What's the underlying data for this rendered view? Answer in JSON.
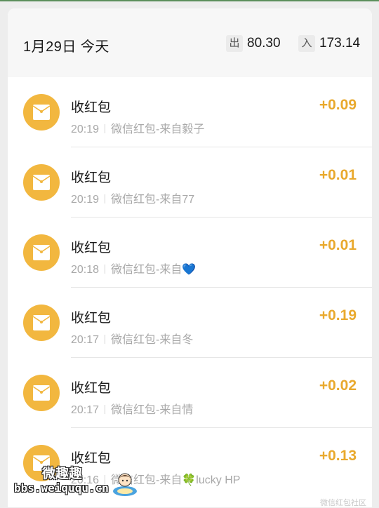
{
  "header": {
    "date": "1月29日 今天",
    "out_tag": "出",
    "out_value": "80.30",
    "in_tag": "入",
    "in_value": "173.14"
  },
  "rows": [
    {
      "title": "收红包",
      "time": "20:19",
      "desc": "微信红包-来自毅子",
      "amount": "+0.09"
    },
    {
      "title": "收红包",
      "time": "20:19",
      "desc": "微信红包-来自77",
      "amount": "+0.01"
    },
    {
      "title": "收红包",
      "time": "20:18",
      "desc": "微信红包-来自💙",
      "amount": "+0.01"
    },
    {
      "title": "收红包",
      "time": "20:17",
      "desc": "微信红包-来自冬",
      "amount": "+0.19"
    },
    {
      "title": "收红包",
      "time": "20:17",
      "desc": "微信红包-来自情",
      "amount": "+0.02"
    },
    {
      "title": "收红包",
      "time": "20:16",
      "desc": "微信红包-来自🍀lucky HP",
      "amount": "+0.13"
    }
  ],
  "watermark": {
    "cn": "微趣趣",
    "url": "bbs.weiququ.cn",
    "corner": "微信红包社区"
  },
  "colors": {
    "accent": "#f2b73f",
    "amount": "#e9a92d",
    "background": "#ededed"
  },
  "icons": {
    "row_icon": "red-packet-icon"
  }
}
